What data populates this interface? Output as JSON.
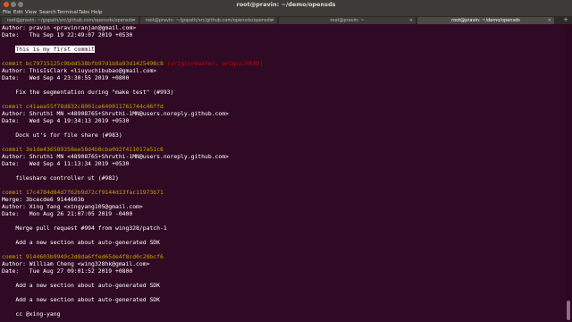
{
  "window": {
    "title": "root@pravin: ~/demo/opensds"
  },
  "colors": {
    "background": "#300a24",
    "commit_hash": "#c4a000",
    "ref_names": "#cc0000",
    "text": "#ffffff"
  },
  "menu": [
    "File",
    "Edit",
    "View",
    "Search",
    "Terminal",
    "Tabs",
    "Help"
  ],
  "tabs": [
    {
      "label": "root@pravin: ~/gopath/src/github.com/opensds/opensds"
    },
    {
      "label": "root@pravin: ~/gopath/src/github.com/opensds/opensds"
    },
    {
      "label": "root@pravin: ~"
    },
    {
      "label": "root@pravin: ~/demo/opensds"
    }
  ],
  "log": {
    "top_author": "Author: pravin <pravinranjan@gmail.com>",
    "top_date": "Date:   Thu Sep 19 22:49:07 2019 +0530",
    "top_message": "This is my first commit",
    "commits": [
      {
        "hash": "commit bc79715125c9bdd538bfb97d1b8a93d1425498c8",
        "refs": " (origin/master, origin/HEAD)",
        "author": "Author: ThisIsClark <liuyuchibubao@gmail.com>",
        "date": "Date:   Wed Sep 4 23:30:55 2019 +0800",
        "message": "    Fix the segmentation during \"make test\" (#993)"
      },
      {
        "hash": "commit c41aea55f78d832c8001ce640011761744c46ffd",
        "author": "Author: Shruthi MN <48908765+Shruthi-1MN@users.noreply.github.com>",
        "date": "Date:   Wed Sep 4 19:34:13 2019 +0530",
        "message": "    Dock ut's for file share (#983)"
      },
      {
        "hash": "commit 3e1de436589358ee58d4b8cba0d2f411017a51c6",
        "author": "Author: Shruthi MN <48908765+Shruthi-1MN@users.noreply.github.com>",
        "date": "Date:   Wed Sep 4 11:13:34 2019 +0530",
        "message": "    fileshare controller ut (#982)"
      },
      {
        "hash": "commit 17c4784d84d7f62b9d72cf9144d13fac11973b71",
        "merge": "Merge: 3bcecde6 9144603b",
        "author": "Author: Xing Yang <xingyang105@gmail.com>",
        "date": "Date:   Mon Aug 26 21:07:05 2019 -0400",
        "message": "    Merge pull request #994 from wing328/patch-1",
        "message2": "    Add a new section about auto-generated SDK"
      },
      {
        "hash": "commit 9144603b9949c2d8da6ffed65de4f8cd0c28bcf6",
        "author": "Author: William Cheng <wing328hk@gmail.com>",
        "date": "Date:   Tue Aug 27 09:01:52 2019 +0800",
        "message": "    Add a new section about auto-generated SDK",
        "message2": "    Add a new section about auto-generated SDK",
        "message3": "    cc @xing-yang"
      }
    ]
  }
}
